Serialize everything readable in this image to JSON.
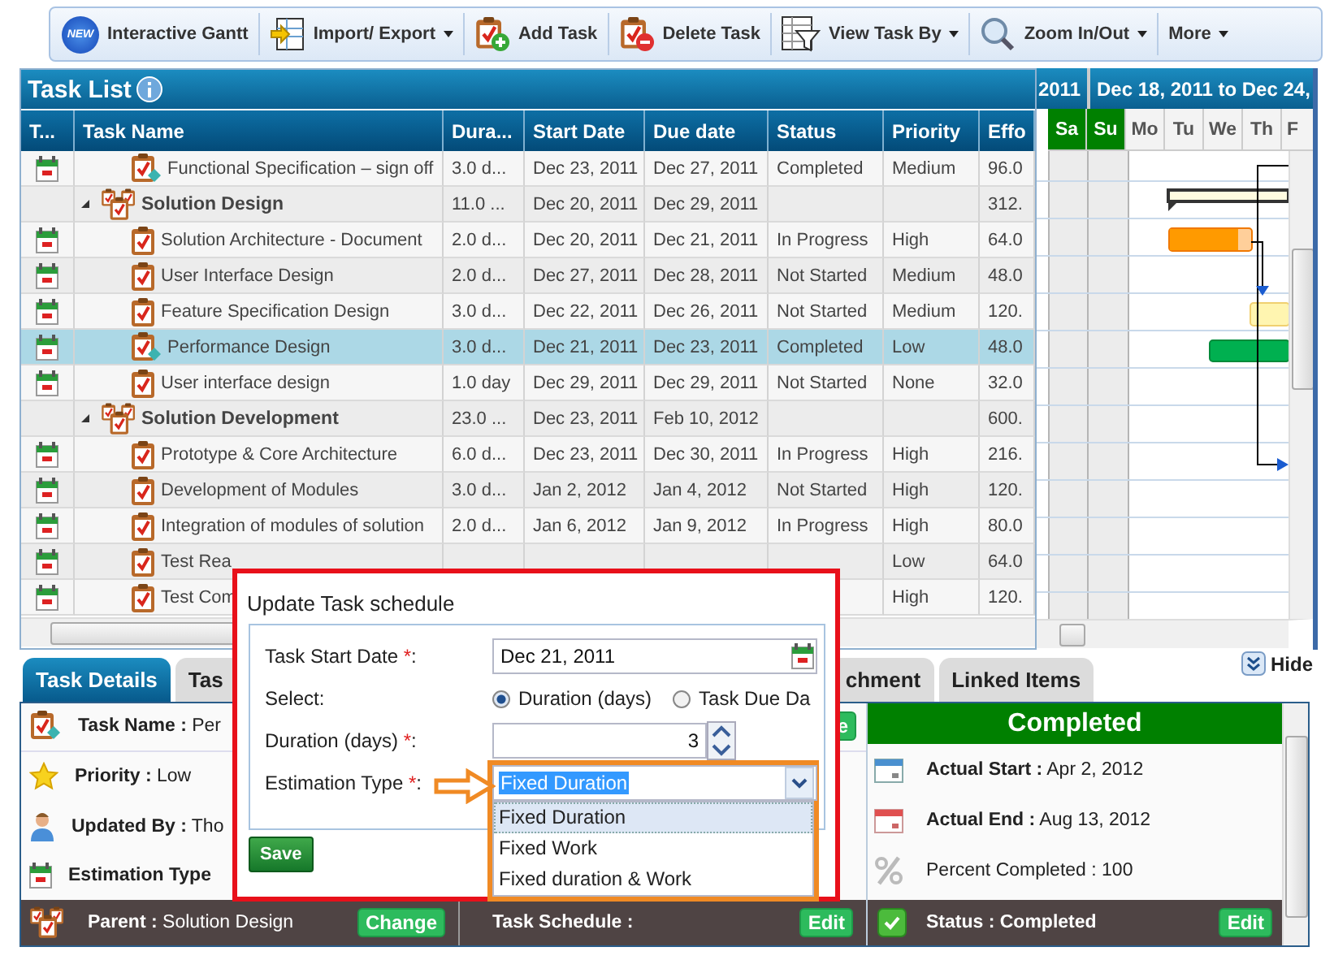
{
  "toolbar": [
    {
      "label": "Interactive Gantt",
      "badge": "NEW",
      "dropdown": false
    },
    {
      "label": "Import/ Export",
      "kind": "import",
      "dropdown": true
    },
    {
      "label": "Add Task",
      "kind": "add",
      "dropdown": false
    },
    {
      "label": "Delete Task",
      "kind": "delete",
      "dropdown": false
    },
    {
      "label": "View Task By",
      "kind": "view",
      "dropdown": true
    },
    {
      "label": "Zoom In/Out",
      "kind": "zoom",
      "dropdown": true
    },
    {
      "label": "More",
      "dropdown": true
    }
  ],
  "task_list": {
    "title": "Task List",
    "columns": [
      "T...",
      "Task Name",
      "Dura...",
      "Start Date",
      "Due date",
      "Status",
      "Priority",
      "Effo"
    ],
    "rows": [
      {
        "kind": "milestone",
        "selected": false,
        "name": "Functional Specification – sign off",
        "duration": "3.0 d...",
        "start": "Dec 23, 2011",
        "due": "Dec 27, 2011",
        "status": "Completed",
        "priority": "Medium",
        "effort": "96.0"
      },
      {
        "kind": "summary",
        "selected": false,
        "expanded": true,
        "name": "Solution Design",
        "duration": "11.0 ...",
        "start": "Dec 20, 2011",
        "due": "Dec 29, 2011",
        "effort": "312.",
        "children": [
          {
            "kind": "task",
            "selected": false,
            "name": "Solution Architecture - Document",
            "duration": "2.0 d...",
            "start": "Dec 20, 2011",
            "due": "Dec 21, 2011",
            "status": "In Progress",
            "priority": "High",
            "effort": "64.0"
          },
          {
            "kind": "task",
            "selected": false,
            "name": "User Interface Design",
            "duration": "2.0 d...",
            "start": "Dec 27, 2011",
            "due": "Dec 28, 2011",
            "status": "Not Started",
            "priority": "Medium",
            "effort": "48.0"
          },
          {
            "kind": "task",
            "selected": false,
            "name": "Feature Specification Design",
            "duration": "3.0 d...",
            "start": "Dec 22, 2011",
            "due": "Dec 26, 2011",
            "status": "Not Started",
            "priority": "Medium",
            "effort": "120."
          },
          {
            "kind": "milestone",
            "selected": true,
            "name": "Performance Design",
            "duration": "3.0 d...",
            "start": "Dec 21, 2011",
            "due": "Dec 23, 2011",
            "status": "Completed",
            "priority": "Low",
            "effort": "48.0"
          },
          {
            "kind": "task",
            "selected": false,
            "name": "User interface design",
            "duration": "1.0 day",
            "start": "Dec 29, 2011",
            "due": "Dec 29, 2011",
            "status": "Not Started",
            "priority": "None",
            "effort": "32.0"
          }
        ]
      },
      {
        "kind": "summary",
        "selected": false,
        "expanded": true,
        "name": "Solution Development",
        "duration": "23.0 ...",
        "start": "Dec 23, 2011",
        "due": "Feb 10, 2012",
        "effort": "600.",
        "children": [
          {
            "kind": "task",
            "selected": false,
            "name": "Prototype & Core Architecture",
            "duration": "6.0 d...",
            "start": "Dec 23, 2011",
            "due": "Dec 30, 2011",
            "status": "In Progress",
            "priority": "High",
            "effort": "216."
          },
          {
            "kind": "task",
            "selected": false,
            "name": "Development of Modules",
            "duration": "3.0 d...",
            "start": "Jan 2, 2012",
            "due": "Jan 4, 2012",
            "status": "Not Started",
            "priority": "High",
            "effort": "120."
          },
          {
            "kind": "task",
            "selected": false,
            "name": "Integration of modules of solution",
            "duration": "2.0 d...",
            "start": "Jan 6, 2012",
            "due": "Jan 9, 2012",
            "status": "In Progress",
            "priority": "High",
            "effort": "80.0"
          },
          {
            "kind": "task",
            "selected": false,
            "name": "Test Rea",
            "priority": "Low",
            "effort": "64.0"
          },
          {
            "kind": "task",
            "selected": false,
            "name": "Test Com",
            "priority": "High",
            "effort": "120."
          }
        ]
      }
    ]
  },
  "gantt": {
    "periods": [
      "2011",
      "Dec 18, 2011 to Dec 24,"
    ],
    "days": [
      {
        "label": "Sa",
        "weekend": true
      },
      {
        "label": "Su",
        "weekend": true
      },
      {
        "label": "Mo",
        "weekend": false
      },
      {
        "label": "Tu",
        "weekend": false
      },
      {
        "label": "We",
        "weekend": false
      },
      {
        "label": "Th",
        "weekend": false
      },
      {
        "label": "F",
        "weekend": false
      }
    ]
  },
  "detail_tabs": [
    {
      "label": "Task Details",
      "selected": true
    },
    {
      "label": "Tas",
      "selected": false
    },
    {
      "label": "chment",
      "selected": false
    },
    {
      "label": "Linked Items",
      "selected": false
    }
  ],
  "hide_button": "Hide",
  "details": {
    "rows": [
      {
        "kind": "milestone",
        "text": "**Task Name :** Per",
        "button": "e"
      },
      {
        "kind": "star",
        "text": "**Priority :** Low"
      },
      {
        "kind": "user",
        "text": "**Updated By :** Tho"
      },
      {
        "kind": "calendar",
        "text": "**Estimation Type**"
      }
    ],
    "footer": [
      {
        "kind": "summary",
        "text": "**Parent :** Solution Design",
        "button": "Change"
      },
      {
        "text": "**Task Schedule :**",
        "button": "Edit"
      }
    ],
    "status_header": "Completed",
    "status_rows": [
      {
        "kind": "calendar-start",
        "text": "**Actual Start :** Apr 2, 2012"
      },
      {
        "kind": "calendar-end",
        "text": "**Actual End :** Aug 13, 2012"
      },
      {
        "kind": "percent",
        "text": "Percent Completed : 100"
      }
    ],
    "status_footer": {
      "kind": "check",
      "text": "Status : Completed",
      "button": "Edit"
    }
  },
  "modal": {
    "title": "Update Task schedule",
    "fields": [
      {
        "kind": "date",
        "label": "Task Start Date ",
        "required": "*",
        "colon": ":",
        "value": "Dec 21, 2011"
      },
      {
        "kind": "radio",
        "label": "Select:",
        "options": [
          {
            "label": "Duration (days)",
            "selected": true
          },
          {
            "label": "Task Due Da",
            "selected": false
          }
        ]
      },
      {
        "kind": "spin",
        "label": "Duration (days) ",
        "required": "*",
        "colon": ":",
        "value": "3"
      },
      {
        "kind": "select",
        "label": "Estimation Type ",
        "required": "*",
        "colon": ":",
        "value": "Fixed Duration",
        "expanded": true,
        "options": [
          {
            "label": "Fixed Duration",
            "selected": true
          },
          {
            "label": "Fixed Work",
            "selected": false
          },
          {
            "label": "Fixed duration & Work",
            "selected": false
          }
        ]
      }
    ],
    "save": "Save"
  }
}
